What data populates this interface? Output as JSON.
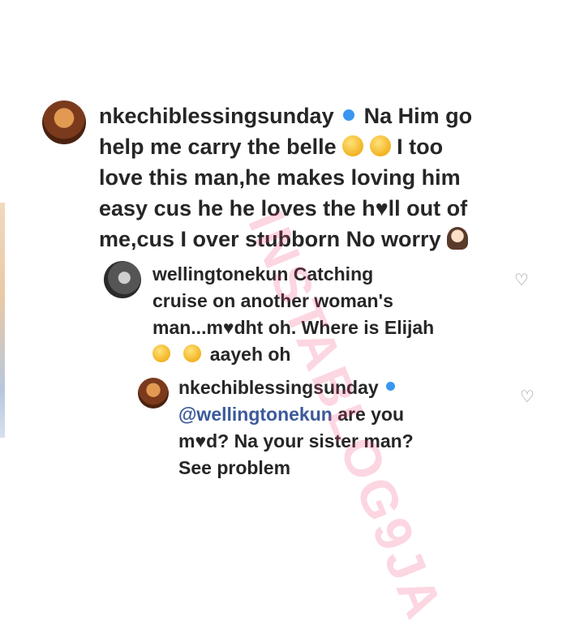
{
  "comment_main": {
    "username": "nkechiblessingsunday",
    "text_line1": "Na Him go",
    "text_line2a": "help me carry the belle",
    "text_line2b": "I too",
    "text_line3": "love this man,he makes loving him",
    "text_line4": "easy cus he he loves the h♥ll out of",
    "text_line5": "me,cus I over stubborn No worry",
    "emoji_1": "rolling-laughing-emoji",
    "emoji_2": "rolling-laughing-emoji",
    "emoji_3": "woman-shrugging-emoji"
  },
  "reply_1": {
    "username": "wellingtonekun",
    "text_line1": "Catching",
    "text_line2": "cruise on another woman's",
    "text_line3": "man...m♥dht oh. Where is Elijah",
    "text_line4": "aayeh oh",
    "emoji_1": "worried-face-emoji",
    "emoji_2": "grinning-face-emoji"
  },
  "reply_2": {
    "username": "nkechiblessingsunday",
    "mention": "@wellingtonekun",
    "text_line1": "are you",
    "text_line2": "m♥d? Na your sister man?",
    "text_line3": "See problem"
  },
  "watermark": "INSTABLOG9JA",
  "colors": {
    "verified": "#3897f0",
    "mention": "#3b5a9a",
    "text": "#262626",
    "heart": "#8e8e8e"
  }
}
